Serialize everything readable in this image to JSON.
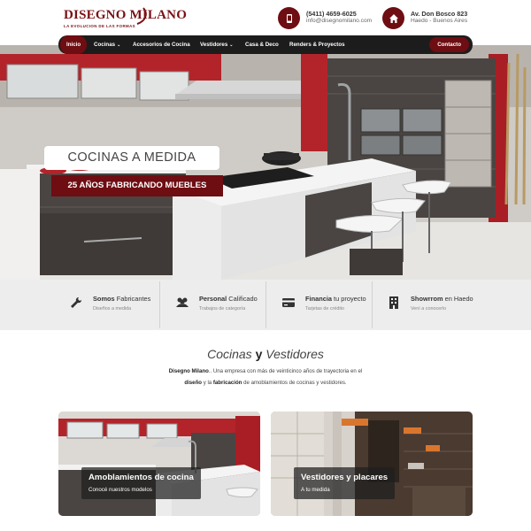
{
  "brand": {
    "name": "DISEGNO MILANO",
    "tagline": "LA EVOLUCION DE LAS FORMAS"
  },
  "contact": {
    "phone": "(5411) 4659-6025",
    "email": "info@disegnomilano.com",
    "address_line1": "Av. Don Bosco 823",
    "address_line2": "Haedo - Buenos Aires"
  },
  "nav": {
    "items": [
      {
        "label": "Inicio"
      },
      {
        "label": "Cocinas"
      },
      {
        "label": "Accesorios de Cocina"
      },
      {
        "label": "Vestidores"
      },
      {
        "label": "Casa & Deco"
      },
      {
        "label": "Renders & Proyectos"
      }
    ],
    "dropdown_caret": "⌄",
    "contact_button": "Contacto"
  },
  "hero": {
    "title": "COCINAS A MEDIDA",
    "subtitle": "25 AÑOS FABRICANDO MUEBLES"
  },
  "features": [
    {
      "title_bold": "Somos",
      "title_rest": "Fabricantes",
      "subtitle": "Diseños a medida",
      "icon": "wrench-icon"
    },
    {
      "title_bold": "Personal",
      "title_rest": "Calificado",
      "subtitle": "Trabajos de categoría",
      "icon": "people-icon"
    },
    {
      "title_bold": "Financia",
      "title_rest": "tu proyecto",
      "subtitle": "Tarjetas de crédito",
      "icon": "credit-card-icon"
    },
    {
      "title_bold": "Showrrom",
      "title_rest": "en Haedo",
      "subtitle": "Vení a conocerlo",
      "icon": "building-icon"
    }
  ],
  "intro": {
    "heading_part1": "Cocinas",
    "heading_connector": "y",
    "heading_part2": "Vestidores",
    "text_brand": "Disegno Milano",
    "text_1": ".. Una empresa con más de veinticinco años de trayectoria en el",
    "text_bold1": "diseño",
    "text_2": " y la ",
    "text_bold2": "fabricación",
    "text_3": " de amoblamientos de cocinas y vestidores."
  },
  "cards": [
    {
      "title": "Amoblamientos de cocina",
      "subtitle": "Conocé nuestros modelos"
    },
    {
      "title": "Vestidores y placares",
      "subtitle": "A tu medida"
    }
  ],
  "colors": {
    "brand": "#6e0d12",
    "nav_bg": "#1c1c1c",
    "features_bg": "#ededed"
  }
}
